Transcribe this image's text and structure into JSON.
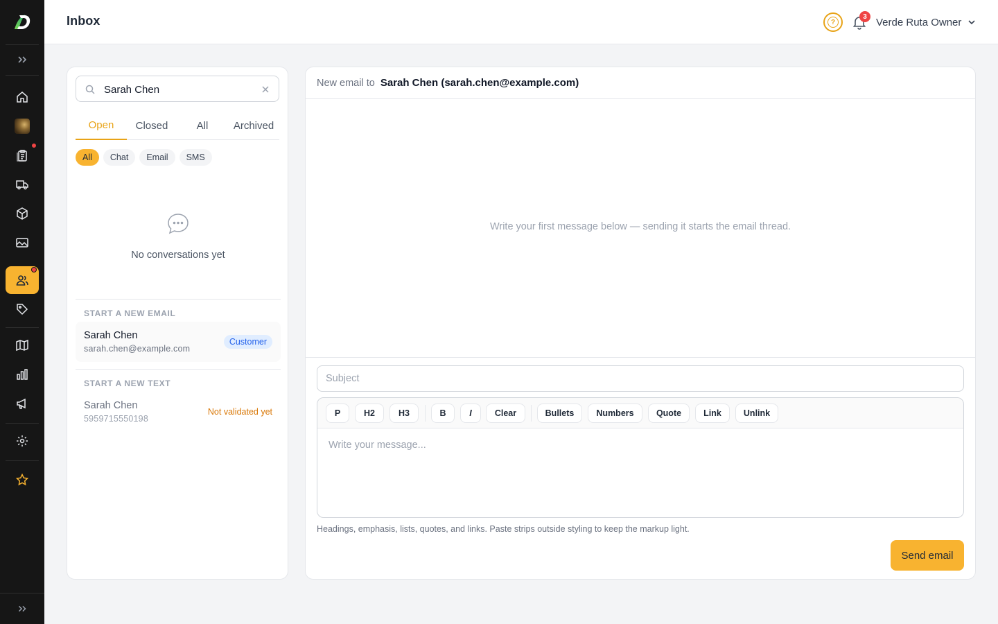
{
  "colors": {
    "accent": "#f8b330",
    "accent_text": "#e8a317",
    "sidebar_bg": "#161616",
    "alert": "#ef4444",
    "badge_blue": "#2563eb",
    "warning": "#d97706"
  },
  "sidebar": {
    "logo": "brand-d-logo",
    "items": [
      {
        "icon": "home-icon"
      },
      {
        "icon": "photo-thumbnail"
      },
      {
        "icon": "clipboard-icon",
        "has_dot": true
      },
      {
        "icon": "truck-icon"
      },
      {
        "icon": "box-icon"
      },
      {
        "icon": "image-icon"
      },
      {
        "icon": "users-icon",
        "active": true,
        "has_dot": true
      },
      {
        "icon": "tag-icon"
      },
      {
        "icon": "map-icon"
      },
      {
        "icon": "bar-chart-icon"
      },
      {
        "icon": "megaphone-icon"
      },
      {
        "icon": "gear-icon"
      },
      {
        "icon": "star-icon"
      }
    ]
  },
  "header": {
    "title": "Inbox",
    "notifications_count": "3",
    "user_name": "Verde Ruta Owner"
  },
  "conversations": {
    "search_value": "Sarah Chen",
    "tabs": [
      "Open",
      "Closed",
      "All",
      "Archived"
    ],
    "active_tab": "Open",
    "channel_filters": [
      "All",
      "Chat",
      "Email",
      "SMS"
    ],
    "active_filter": "All",
    "empty_text": "No conversations yet",
    "new_email": {
      "label": "START A NEW EMAIL",
      "name": "Sarah Chen",
      "email": "sarah.chen@example.com",
      "badge": "Customer"
    },
    "new_text": {
      "label": "START A NEW TEXT",
      "name": "Sarah Chen",
      "phone": "5959715550198",
      "status": "Not validated yet"
    }
  },
  "composer": {
    "to_label": "New email to",
    "to_value": "Sarah Chen (sarah.chen@example.com)",
    "thread_hint": "Write your first message below — sending it starts the email thread.",
    "subject_placeholder": "Subject",
    "toolbar": {
      "p": "P",
      "h2": "H2",
      "h3": "H3",
      "bold": "B",
      "italic": "I",
      "clear": "Clear",
      "bullets": "Bullets",
      "numbers": "Numbers",
      "quote": "Quote",
      "link": "Link",
      "unlink": "Unlink"
    },
    "body_placeholder": "Write your message...",
    "help_text": "Headings, emphasis, lists, quotes, and links. Paste strips outside styling to keep the markup light.",
    "send_label": "Send email"
  }
}
